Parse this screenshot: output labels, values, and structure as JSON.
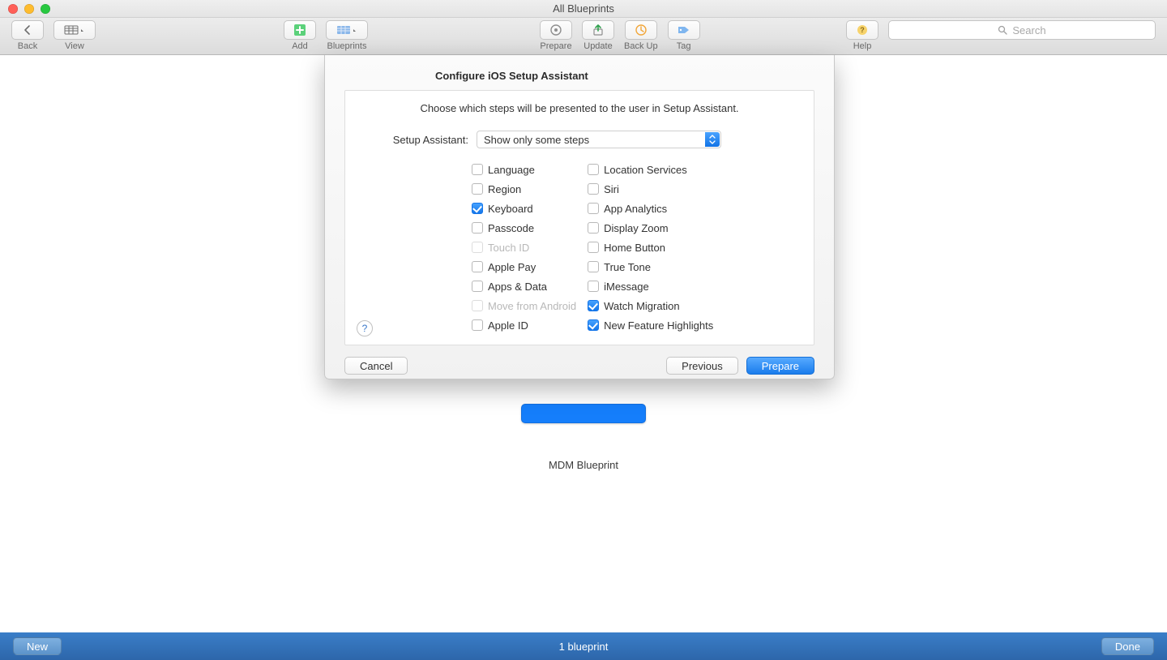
{
  "window": {
    "title": "All Blueprints"
  },
  "traffic": {
    "close": "#ff5f57",
    "min": "#febc2e",
    "zoom": "#28c840"
  },
  "toolbar": {
    "back": "Back",
    "view": "View",
    "add": "Add",
    "blueprints": "Blueprints",
    "prepare": "Prepare",
    "update": "Update",
    "backup": "Back Up",
    "tag": "Tag",
    "help": "Help",
    "search_placeholder": "Search"
  },
  "blueprint": {
    "label": "MDM Blueprint"
  },
  "sheet": {
    "title": "Configure iOS Setup Assistant",
    "instruction": "Choose which steps will be presented to the user in Setup Assistant.",
    "select_label": "Setup Assistant:",
    "select_value": "Show only some steps",
    "col1": [
      {
        "label": "Language",
        "checked": false,
        "disabled": false
      },
      {
        "label": "Region",
        "checked": false,
        "disabled": false
      },
      {
        "label": "Keyboard",
        "checked": true,
        "disabled": false
      },
      {
        "label": "Passcode",
        "checked": false,
        "disabled": false
      },
      {
        "label": "Touch ID",
        "checked": false,
        "disabled": true
      },
      {
        "label": "Apple Pay",
        "checked": false,
        "disabled": false
      },
      {
        "label": "Apps & Data",
        "checked": false,
        "disabled": false
      },
      {
        "label": "Move from Android",
        "checked": false,
        "disabled": true
      },
      {
        "label": "Apple ID",
        "checked": false,
        "disabled": false
      }
    ],
    "col2": [
      {
        "label": "Location Services",
        "checked": false,
        "disabled": false
      },
      {
        "label": "Siri",
        "checked": false,
        "disabled": false
      },
      {
        "label": "App Analytics",
        "checked": false,
        "disabled": false
      },
      {
        "label": "Display Zoom",
        "checked": false,
        "disabled": false
      },
      {
        "label": "Home Button",
        "checked": false,
        "disabled": false
      },
      {
        "label": "True Tone",
        "checked": false,
        "disabled": false
      },
      {
        "label": "iMessage",
        "checked": false,
        "disabled": false
      },
      {
        "label": "Watch Migration",
        "checked": true,
        "disabled": false
      },
      {
        "label": "New Feature Highlights",
        "checked": true,
        "disabled": false
      }
    ],
    "cancel": "Cancel",
    "previous": "Previous",
    "prepare": "Prepare"
  },
  "bottombar": {
    "new": "New",
    "count": "1 blueprint",
    "done": "Done"
  }
}
